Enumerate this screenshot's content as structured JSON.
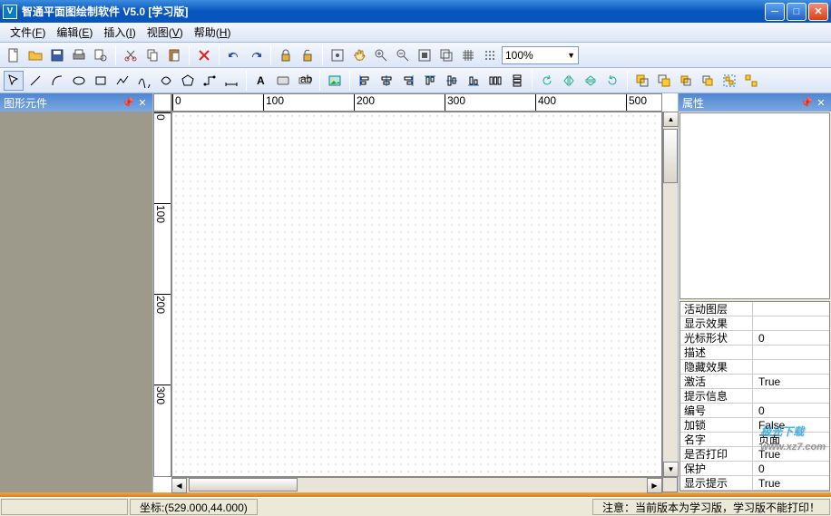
{
  "window": {
    "title": "智通平面图绘制软件  V5.0  [学习版]"
  },
  "menu": {
    "file": {
      "label": "文件",
      "accel": "F"
    },
    "edit": {
      "label": "编辑",
      "accel": "E"
    },
    "insert": {
      "label": "插入",
      "accel": "I"
    },
    "view": {
      "label": "视图",
      "accel": "V"
    },
    "help": {
      "label": "帮助",
      "accel": "H"
    }
  },
  "toolbar1": {
    "zoom": "100%"
  },
  "panels": {
    "shapes": {
      "title": "图形元件"
    },
    "properties": {
      "title": "属性"
    }
  },
  "hruler": {
    "ticks": [
      0,
      100,
      200,
      300,
      400,
      500
    ]
  },
  "vruler": {
    "ticks": [
      0,
      100,
      200,
      300
    ]
  },
  "properties": {
    "rows": [
      {
        "name": "活动图层",
        "value": ""
      },
      {
        "name": "显示效果",
        "value": ""
      },
      {
        "name": "光标形状",
        "value": "0"
      },
      {
        "name": "描述",
        "value": ""
      },
      {
        "name": "隐藏效果",
        "value": ""
      },
      {
        "name": "激活",
        "value": "True"
      },
      {
        "name": "提示信息",
        "value": ""
      },
      {
        "name": "编号",
        "value": "0"
      },
      {
        "name": "加锁",
        "value": "False"
      },
      {
        "name": "名字",
        "value": "页面"
      },
      {
        "name": "是否打印",
        "value": "True"
      },
      {
        "name": "保护",
        "value": "0"
      },
      {
        "name": "显示提示",
        "value": "True"
      }
    ]
  },
  "status": {
    "coord": "坐标:(529.000,44.000)",
    "note": "注意：当前版本为学习版，学习版不能打印！"
  },
  "watermark": {
    "text": "极光下载",
    "url": "www.xz7.com"
  }
}
